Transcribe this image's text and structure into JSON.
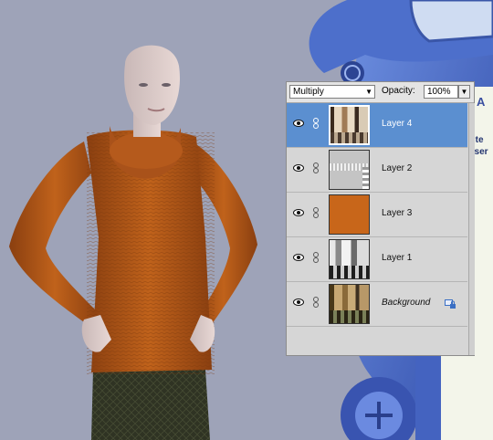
{
  "layers_panel": {
    "blend_mode": "Multiply",
    "opacity_label": "Opacity:",
    "opacity_value": "100%",
    "layers": [
      {
        "name": "Layer 4",
        "selected": true,
        "italic": false,
        "locked": false
      },
      {
        "name": "Layer 2",
        "selected": false,
        "italic": false,
        "locked": false
      },
      {
        "name": "Layer 3",
        "selected": false,
        "italic": false,
        "locked": false
      },
      {
        "name": "Layer 1",
        "selected": false,
        "italic": false,
        "locked": false
      },
      {
        "name": "Background",
        "selected": false,
        "italic": true,
        "locked": true
      }
    ]
  },
  "right_panel_fragments": [
    "A",
    "r te",
    "Jser"
  ],
  "colors": {
    "selection": "#5b8fd0",
    "sweater_orange": "#c0621b",
    "ui_blue": "#3f5fb8"
  },
  "icons": [
    "eye-icon",
    "link-icon",
    "lock-icon",
    "chevron-down-icon"
  ]
}
